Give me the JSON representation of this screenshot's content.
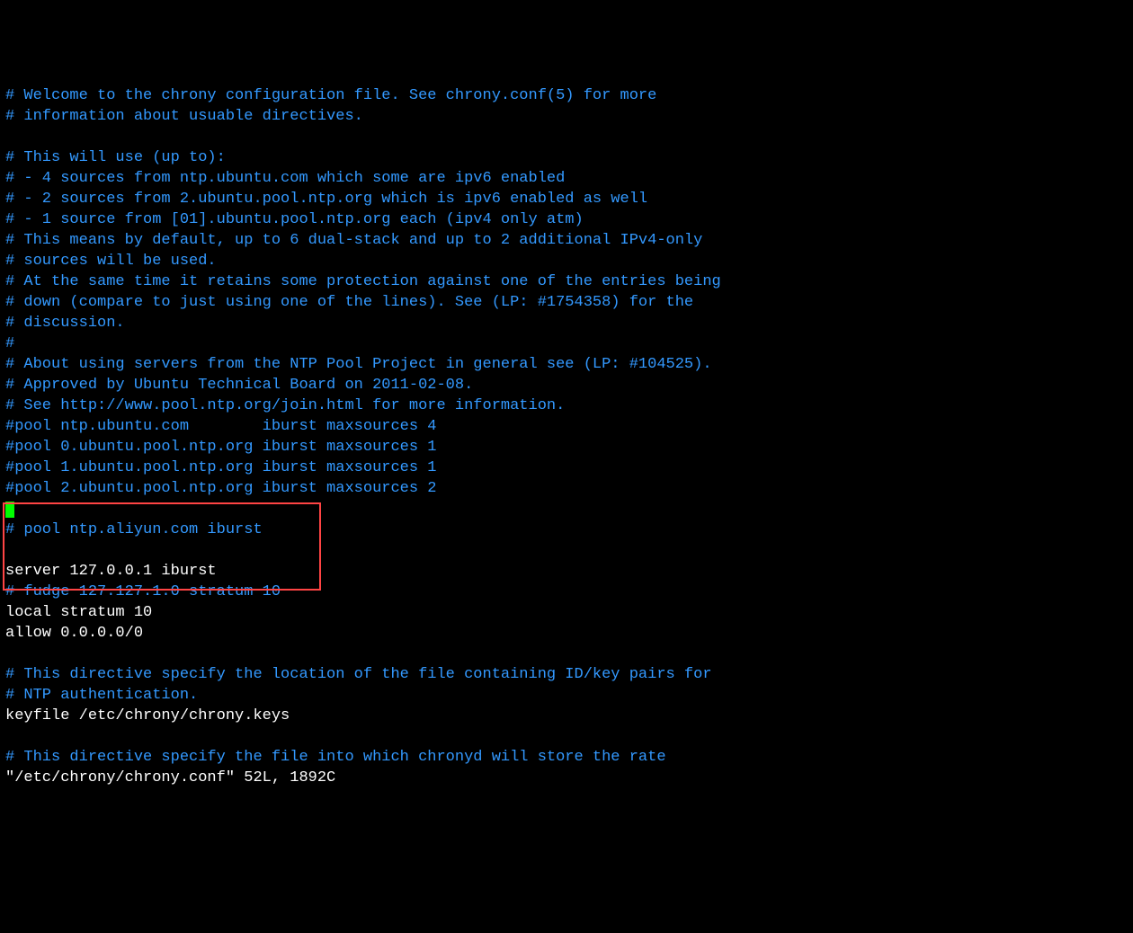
{
  "lines": [
    {
      "type": "comment",
      "text": "# Welcome to the chrony configuration file. See chrony.conf(5) for more"
    },
    {
      "type": "comment",
      "text": "# information about usuable directives."
    },
    {
      "type": "blank",
      "text": ""
    },
    {
      "type": "comment",
      "text": "# This will use (up to):"
    },
    {
      "type": "comment",
      "text": "# - 4 sources from ntp.ubuntu.com which some are ipv6 enabled"
    },
    {
      "type": "comment",
      "text": "# - 2 sources from 2.ubuntu.pool.ntp.org which is ipv6 enabled as well"
    },
    {
      "type": "comment",
      "text": "# - 1 source from [01].ubuntu.pool.ntp.org each (ipv4 only atm)"
    },
    {
      "type": "comment",
      "text": "# This means by default, up to 6 dual-stack and up to 2 additional IPv4-only"
    },
    {
      "type": "comment",
      "text": "# sources will be used."
    },
    {
      "type": "comment",
      "text": "# At the same time it retains some protection against one of the entries being"
    },
    {
      "type": "comment",
      "text": "# down (compare to just using one of the lines). See (LP: #1754358) for the"
    },
    {
      "type": "comment",
      "text": "# discussion."
    },
    {
      "type": "comment",
      "text": "#"
    },
    {
      "type": "comment",
      "text": "# About using servers from the NTP Pool Project in general see (LP: #104525)."
    },
    {
      "type": "comment",
      "text": "# Approved by Ubuntu Technical Board on 2011-02-08."
    },
    {
      "type": "comment",
      "text": "# See http://www.pool.ntp.org/join.html for more information."
    },
    {
      "type": "comment",
      "text": "#pool ntp.ubuntu.com        iburst maxsources 4"
    },
    {
      "type": "comment",
      "text": "#pool 0.ubuntu.pool.ntp.org iburst maxsources 1"
    },
    {
      "type": "comment",
      "text": "#pool 1.ubuntu.pool.ntp.org iburst maxsources 1"
    },
    {
      "type": "comment",
      "text": "#pool 2.ubuntu.pool.ntp.org iburst maxsources 2"
    },
    {
      "type": "cursor",
      "text": ""
    },
    {
      "type": "comment",
      "text": "# pool ntp.aliyun.com iburst"
    },
    {
      "type": "blank",
      "text": ""
    },
    {
      "type": "normal",
      "text": "server 127.0.0.1 iburst"
    },
    {
      "type": "comment",
      "text": "# fudge 127.127.1.0 stratum 10"
    },
    {
      "type": "normal",
      "text": "local stratum 10"
    },
    {
      "type": "normal",
      "text": "allow 0.0.0.0/0"
    },
    {
      "type": "blank",
      "text": ""
    },
    {
      "type": "comment",
      "text": "# This directive specify the location of the file containing ID/key pairs for"
    },
    {
      "type": "comment",
      "text": "# NTP authentication."
    },
    {
      "type": "normal",
      "text": "keyfile /etc/chrony/chrony.keys"
    },
    {
      "type": "blank",
      "text": ""
    },
    {
      "type": "comment",
      "text": "# This directive specify the file into which chronyd will store the rate"
    }
  ],
  "status_line": "\"/etc/chrony/chrony.conf\" 52L, 1892C"
}
